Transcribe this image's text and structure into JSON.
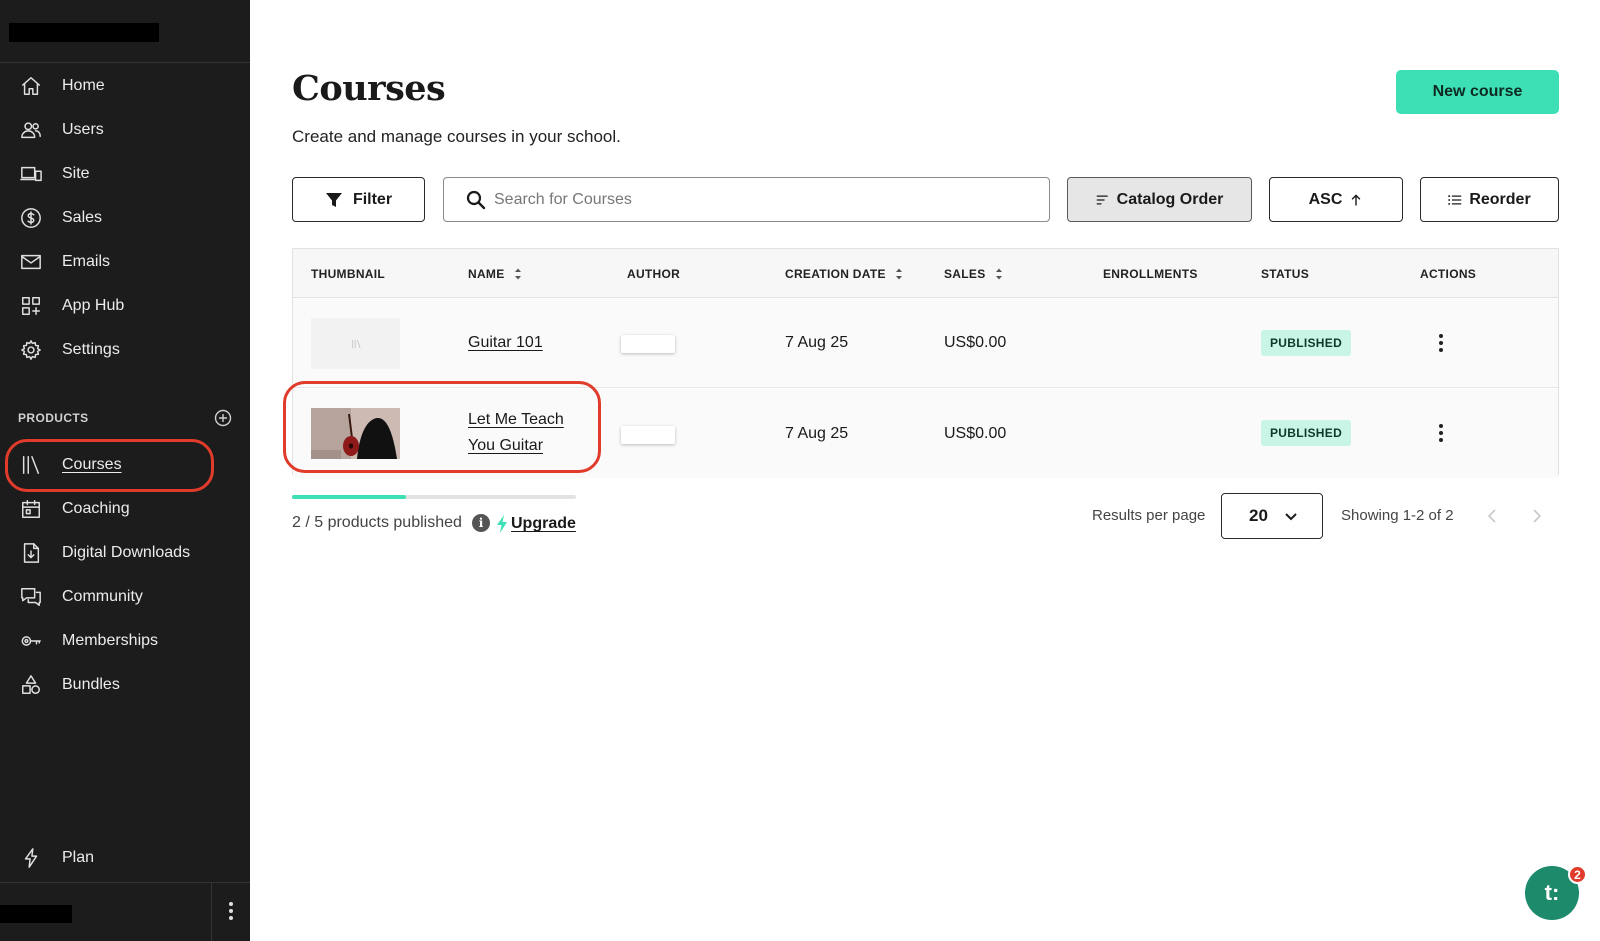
{
  "sidebar": {
    "nav": [
      {
        "label": "Home",
        "icon": "home-icon"
      },
      {
        "label": "Users",
        "icon": "users-icon"
      },
      {
        "label": "Site",
        "icon": "site-icon"
      },
      {
        "label": "Sales",
        "icon": "dollar-icon"
      },
      {
        "label": "Emails",
        "icon": "mail-icon"
      },
      {
        "label": "App Hub",
        "icon": "app-hub-icon"
      },
      {
        "label": "Settings",
        "icon": "gear-icon"
      }
    ],
    "products_heading": "PRODUCTS",
    "products": [
      {
        "label": "Courses",
        "icon": "library-icon",
        "active": true
      },
      {
        "label": "Coaching",
        "icon": "calendar-icon"
      },
      {
        "label": "Digital Downloads",
        "icon": "download-file-icon"
      },
      {
        "label": "Community",
        "icon": "chat-icon"
      },
      {
        "label": "Memberships",
        "icon": "key-icon"
      },
      {
        "label": "Bundles",
        "icon": "shapes-icon"
      }
    ],
    "plan_label": "Plan"
  },
  "header": {
    "title": "Courses",
    "subtitle": "Create and manage courses in your school.",
    "new_button": "New course"
  },
  "toolbar": {
    "filter_label": "Filter",
    "search_placeholder": "Search for Courses",
    "catalog_label": "Catalog Order",
    "asc_label": "ASC",
    "reorder_label": "Reorder"
  },
  "table": {
    "columns": [
      "THUMBNAIL",
      "NAME",
      "AUTHOR",
      "CREATION DATE",
      "SALES",
      "ENROLLMENTS",
      "STATUS",
      "ACTIONS"
    ],
    "rows": [
      {
        "name": "Guitar 101",
        "date": "7 Aug 25",
        "sales": "US$0.00",
        "status": "PUBLISHED"
      },
      {
        "name_line1": "Let Me Teach",
        "name_line2": "You Guitar",
        "date": "7 Aug 25",
        "sales": "US$0.00",
        "status": "PUBLISHED"
      }
    ]
  },
  "footer": {
    "published_text": "2 / 5 products published",
    "published_fraction": 0.4,
    "info_glyph": "i",
    "upgrade_label": "Upgrade",
    "rpp_label": "Results per page",
    "rpp_value": "20",
    "showing": "Showing 1-2 of 2"
  },
  "chat": {
    "glyph": "t:",
    "badge": "2"
  },
  "colors": {
    "accent": "#3ce0b4",
    "sidebar": "#1c1c1c",
    "highlight": "#e03b2b",
    "badge_bg": "#c9f5e6"
  }
}
